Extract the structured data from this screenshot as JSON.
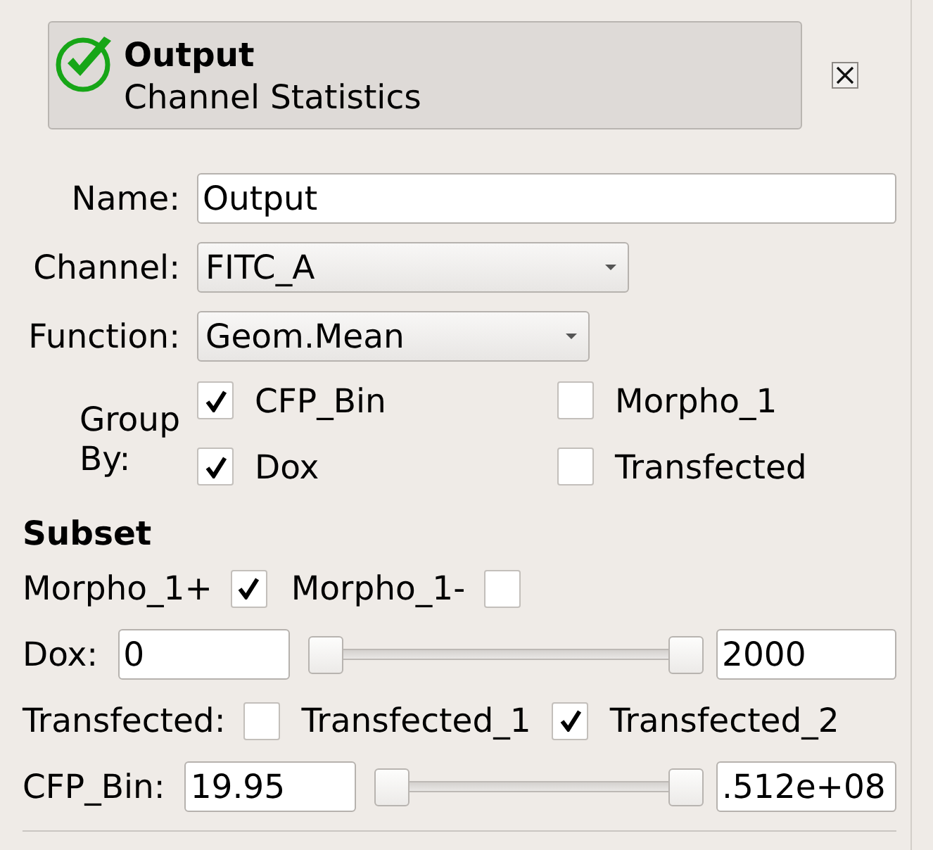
{
  "header": {
    "title": "Output",
    "subtitle": "Channel Statistics"
  },
  "fields": [
    {
      "kind": "text",
      "label": "Name:",
      "value": "Output"
    },
    {
      "kind": "dropdown",
      "label": "Channel:",
      "value": "FITC_A"
    },
    {
      "kind": "dropdown",
      "label": "Function:",
      "value": "Geom.Mean"
    }
  ],
  "group_by": {
    "label": "Group By:",
    "options": [
      {
        "label": "CFP_Bin",
        "checked": true
      },
      {
        "label": "Morpho_1",
        "checked": false
      },
      {
        "label": "Dox",
        "checked": true
      },
      {
        "label": "Transfected",
        "checked": false
      }
    ]
  },
  "subset": {
    "title": "Subset",
    "rows": [
      {
        "kind": "toggles",
        "items": [
          {
            "label": "Morpho_1+",
            "checked": true
          },
          {
            "label": "Morpho_1-",
            "checked": false
          }
        ]
      },
      {
        "kind": "range",
        "label": "Dox:",
        "low": "0",
        "high": "2000",
        "handles": [
          {
            "level": 0
          },
          {
            "level": 1
          }
        ]
      },
      {
        "kind": "choices",
        "label": "Transfected:",
        "items": [
          {
            "label": "Transfected_1",
            "checked": false
          },
          {
            "label": "Transfected_2",
            "checked": true
          }
        ]
      },
      {
        "kind": "range",
        "label": "CFP_Bin:",
        "low": "19.95",
        "high": ".512e+08",
        "handles": [
          {
            "level": 0
          },
          {
            "level": 1
          }
        ]
      }
    ]
  }
}
